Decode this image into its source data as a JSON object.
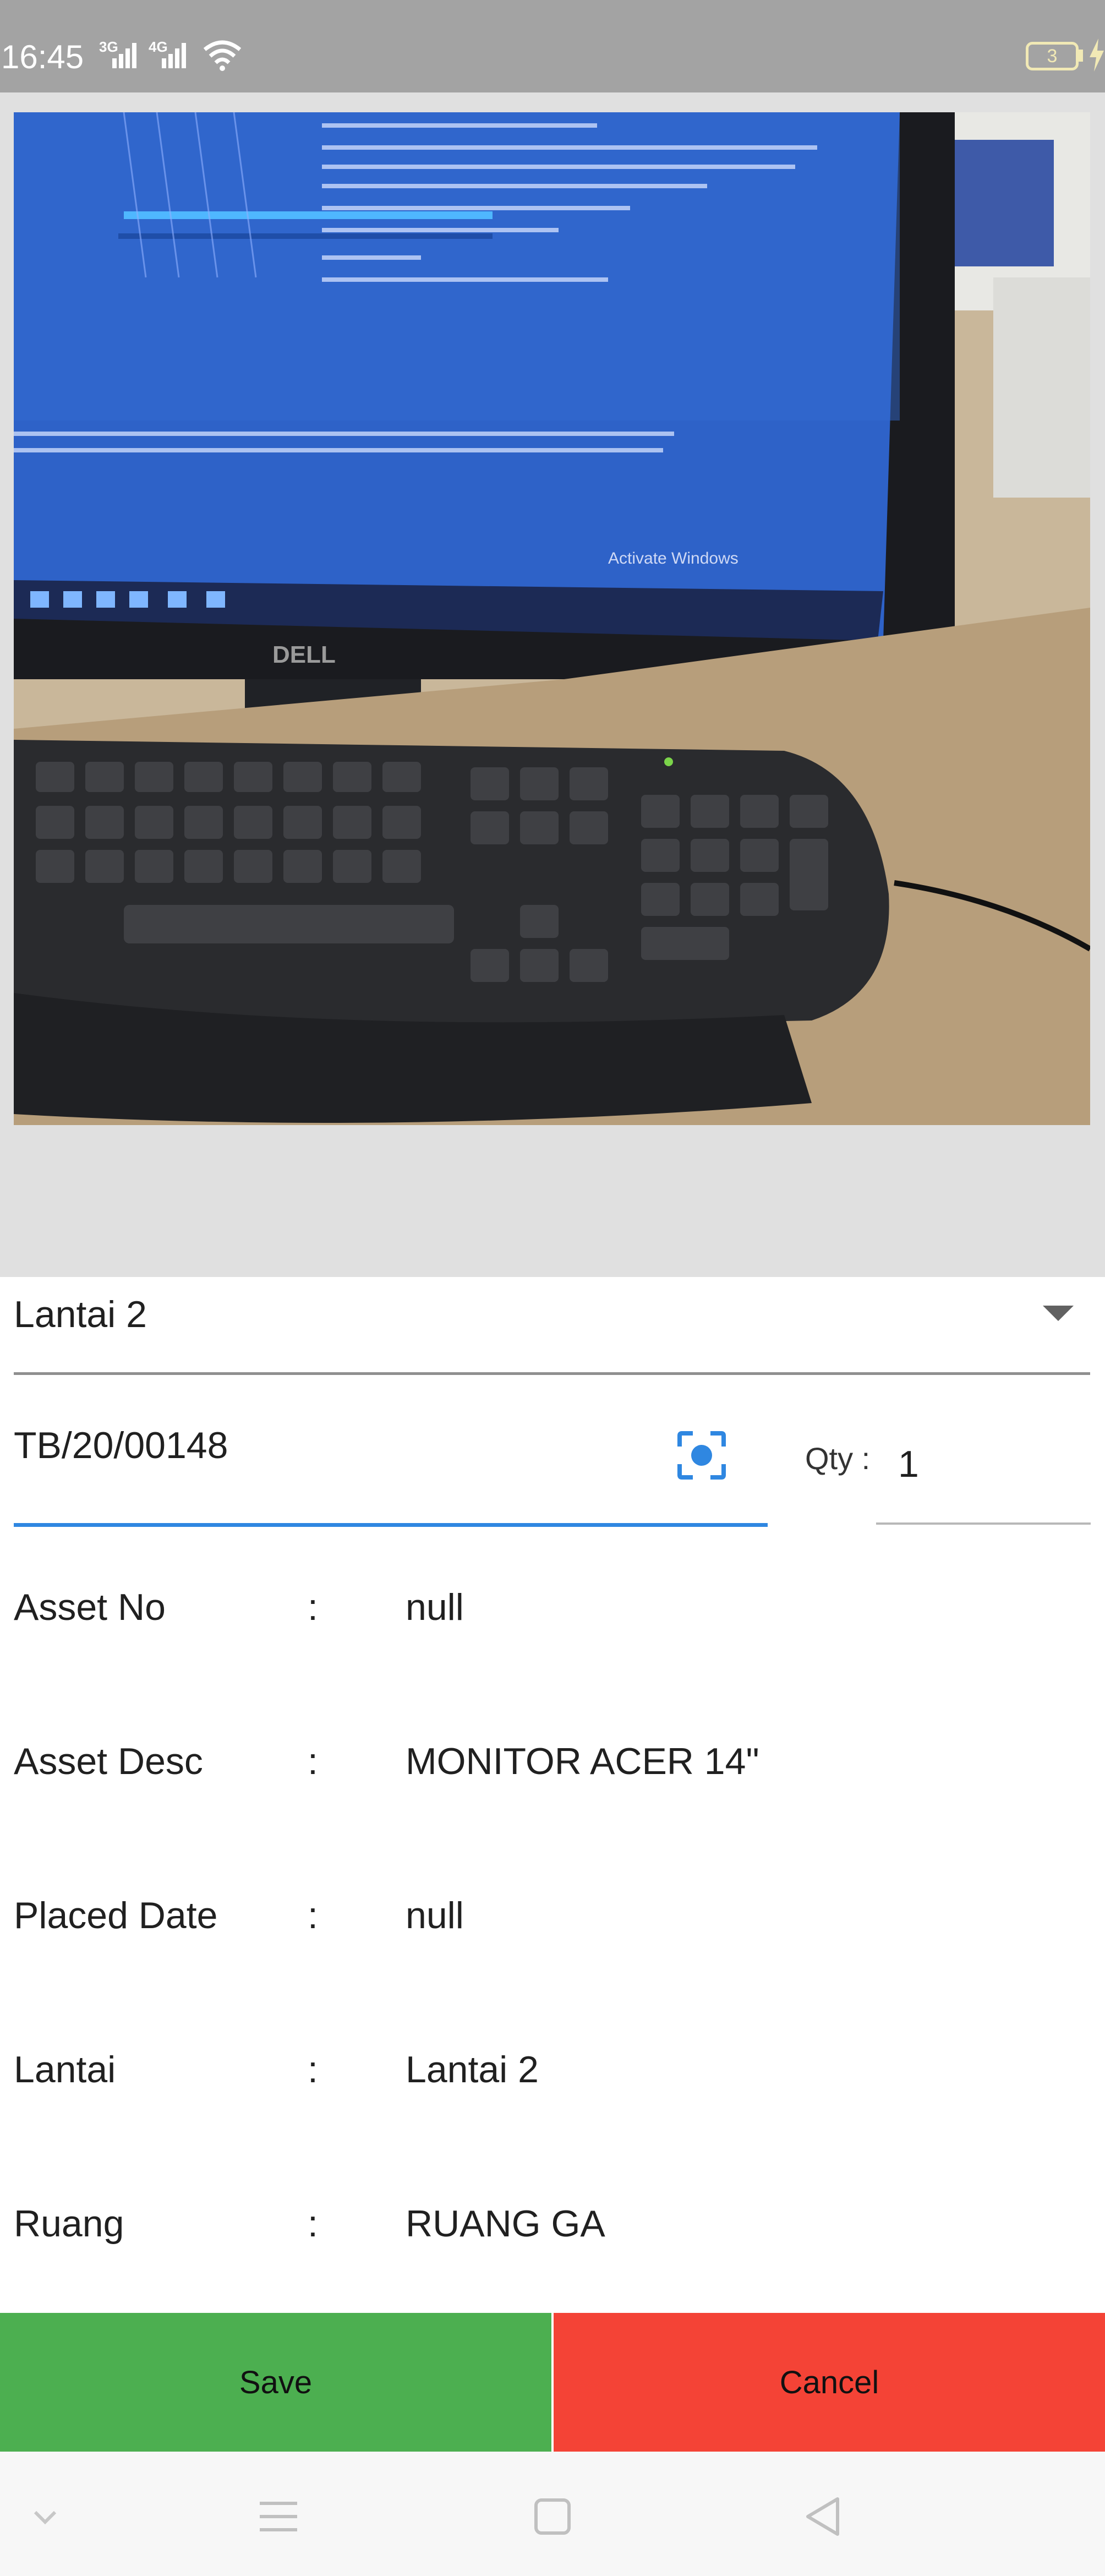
{
  "status_bar": {
    "time": "16:45",
    "network_1": "3G",
    "network_2": "4G",
    "battery_level": "3",
    "icons": [
      "signal-icon",
      "signal-icon",
      "wifi-icon",
      "battery-icon",
      "charging-icon"
    ]
  },
  "photo": {
    "description_icon": "photo-preview",
    "screen_text": "Activate Windows",
    "brand_text": "DELL"
  },
  "form": {
    "location_dropdown": {
      "selected": "Lantai 2",
      "icon": "chevron-down-icon"
    },
    "code_field": {
      "value": "TB/20/00148",
      "scan_icon": "scan-icon"
    },
    "qty": {
      "label": "Qty :",
      "value": "1"
    }
  },
  "details": [
    {
      "label": "Asset No",
      "colon": ":",
      "value": "null"
    },
    {
      "label": "Asset Desc",
      "colon": ":",
      "value": "MONITOR ACER 14\""
    },
    {
      "label": "Placed Date",
      "colon": ":",
      "value": "null"
    },
    {
      "label": "Lantai",
      "colon": ":",
      "value": "Lantai 2"
    },
    {
      "label": "Ruang",
      "colon": ":",
      "value": "RUANG GA"
    }
  ],
  "actions": {
    "save_label": "Save",
    "cancel_label": "Cancel"
  },
  "colors": {
    "status_bar": "#a3a3a3",
    "accent_blue": "#2f87e1",
    "save_green": "#4caf50",
    "cancel_red": "#f44336"
  },
  "nav_bar": {
    "icons": [
      "collapse-icon",
      "menu-icon",
      "home-icon",
      "back-icon"
    ]
  }
}
